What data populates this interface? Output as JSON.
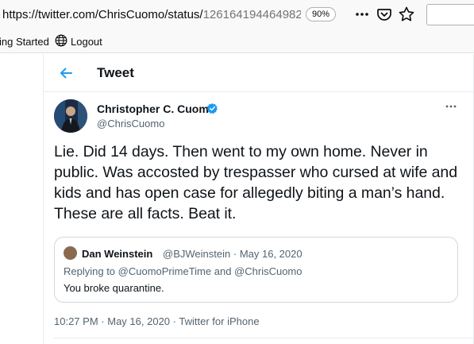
{
  "browser": {
    "url_main": "https://twitter.com/ChrisCuomo/status/",
    "url_tail": "126164194464982",
    "zoom": "90%",
    "icons": [
      "more-icon",
      "pocket-icon",
      "bookmark-star-icon"
    ]
  },
  "bookmarks": {
    "item1": "ing Started",
    "item2": "Logout"
  },
  "header": {
    "title": "Tweet"
  },
  "tweet": {
    "author_name": "Christopher C. Cuomo",
    "author_handle": "@ChrisCuomo",
    "text": "Lie. Did 14 days. Then went to my own home. Never in public. Was accosted by trespasser who cursed at wife and kids and has open case for allegedly biting a man’s hand. These are all facts. Beat it.",
    "time": "10:27 PM",
    "date": "May 16, 2020",
    "source": "Twitter for iPhone",
    "separator": "·"
  },
  "quote": {
    "author_name": "Dan Weinstein",
    "author_handle": "@BJWeinstein",
    "date": "May 16, 2020",
    "replying_prefix": "Replying to ",
    "reply_to_1": "@CuomoPrimeTime",
    "reply_and": " and ",
    "reply_to_2": "@ChrisCuomo",
    "text": "You broke quarantine."
  },
  "colors": {
    "accent": "#1d9bf0",
    "text_primary": "#0f1419",
    "text_secondary": "#536471",
    "border": "#cfd9de"
  }
}
